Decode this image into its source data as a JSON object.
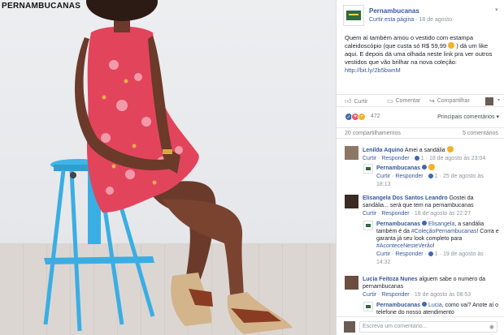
{
  "photo": {
    "brand": "PERNAMBUCANAS"
  },
  "post": {
    "page_name": "Pernambucanas",
    "follow_link": "Curtir esta página",
    "separator": "·",
    "date": "18 de agosto",
    "text_part1": "Quem aí também amou o vestido com estampa caleidoscópio (que custa só R$ 59,99",
    "text_part2": ") dá um like aqui. E depois dá uma olhada neste link pra ver outros vestidos que vão brilhar na nova coleção:",
    "link": "http://bit.ly/2b5bwnM",
    "actions": {
      "like": "Curtir",
      "comment": "Comentar",
      "share": "Compartilhar"
    },
    "reaction_count": "472",
    "top_comments": "Principais comentários",
    "shares": "20 compartilhamentos",
    "comment_count": "5 comentários",
    "write_placeholder": "Escreva um comentário...",
    "colors": {
      "link_blue": "#365899",
      "meta_gray": "#90949c",
      "like_blue": "#4267b2"
    }
  },
  "comments": [
    {
      "author": "Lenilda Aquino",
      "text": "Amei a sandália",
      "reply_label": "Curtir",
      "reply_label2": "Responder",
      "likes": "1",
      "time": "18 de agosto às 23:04"
    },
    {
      "author": "Pernambucanas",
      "text": "",
      "reply_label": "Curtir",
      "reply_label2": "Responder",
      "likes": "1",
      "time": "25 de agosto às",
      "time2": "18:13"
    },
    {
      "author": "Elisangela Dos Santos Leandro",
      "text": "Gostei da sandália... será que tem na pernambucanas",
      "reply_label": "Curtir",
      "reply_label2": "Responder",
      "time": "18 de agosto às 22:27"
    },
    {
      "author": "Pernambucanas",
      "mention": "Elisangela",
      "text": ", a sandália também é da",
      "hashtag": "#ColeçãoPernambucanas",
      "text2": "! Corra e garanta já seu look completo para",
      "hashtag2": "#AconteceNesteVerão",
      "text3": "!",
      "reply_label": "Curtir",
      "reply_label2": "Responder",
      "likes": "1",
      "time": "19 de agosto às",
      "time2": "14:32"
    },
    {
      "author": "Lucia Feitoza Nunes",
      "text": "alguem sabe o numero da pernambucanas",
      "reply_label": "Curtir",
      "reply_label2": "Responder",
      "time": "19 de agosto às 08:53"
    },
    {
      "author": "Pernambucanas",
      "mention": "Lucia",
      "text": ", como vai? Anote aí o telefone do nosso atendimento"
    }
  ]
}
